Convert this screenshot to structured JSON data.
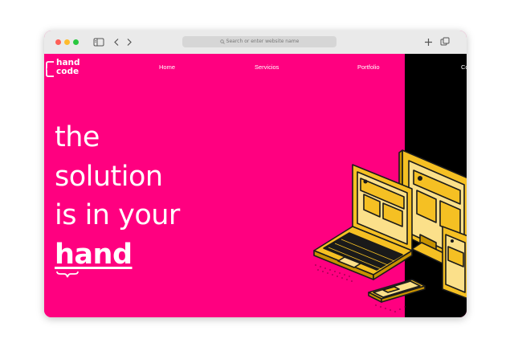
{
  "browser": {
    "address_placeholder": "Search or enter website name",
    "icons": [
      "sidebar-icon",
      "back-icon",
      "forward-icon",
      "search-icon",
      "new-tab-icon",
      "tabs-overview-icon"
    ]
  },
  "site": {
    "logo": {
      "line1": "hand",
      "line2": "code"
    },
    "nav": [
      "Home",
      "Servicios",
      "Portfolio",
      "Co"
    ],
    "hero": {
      "line1": "the",
      "line2": "solution",
      "line3": "is in your",
      "highlight": "hand"
    }
  },
  "colors": {
    "brand": "#ff0080",
    "panel": "#000000",
    "accent": "#f5c023",
    "text": "#ffffff"
  }
}
